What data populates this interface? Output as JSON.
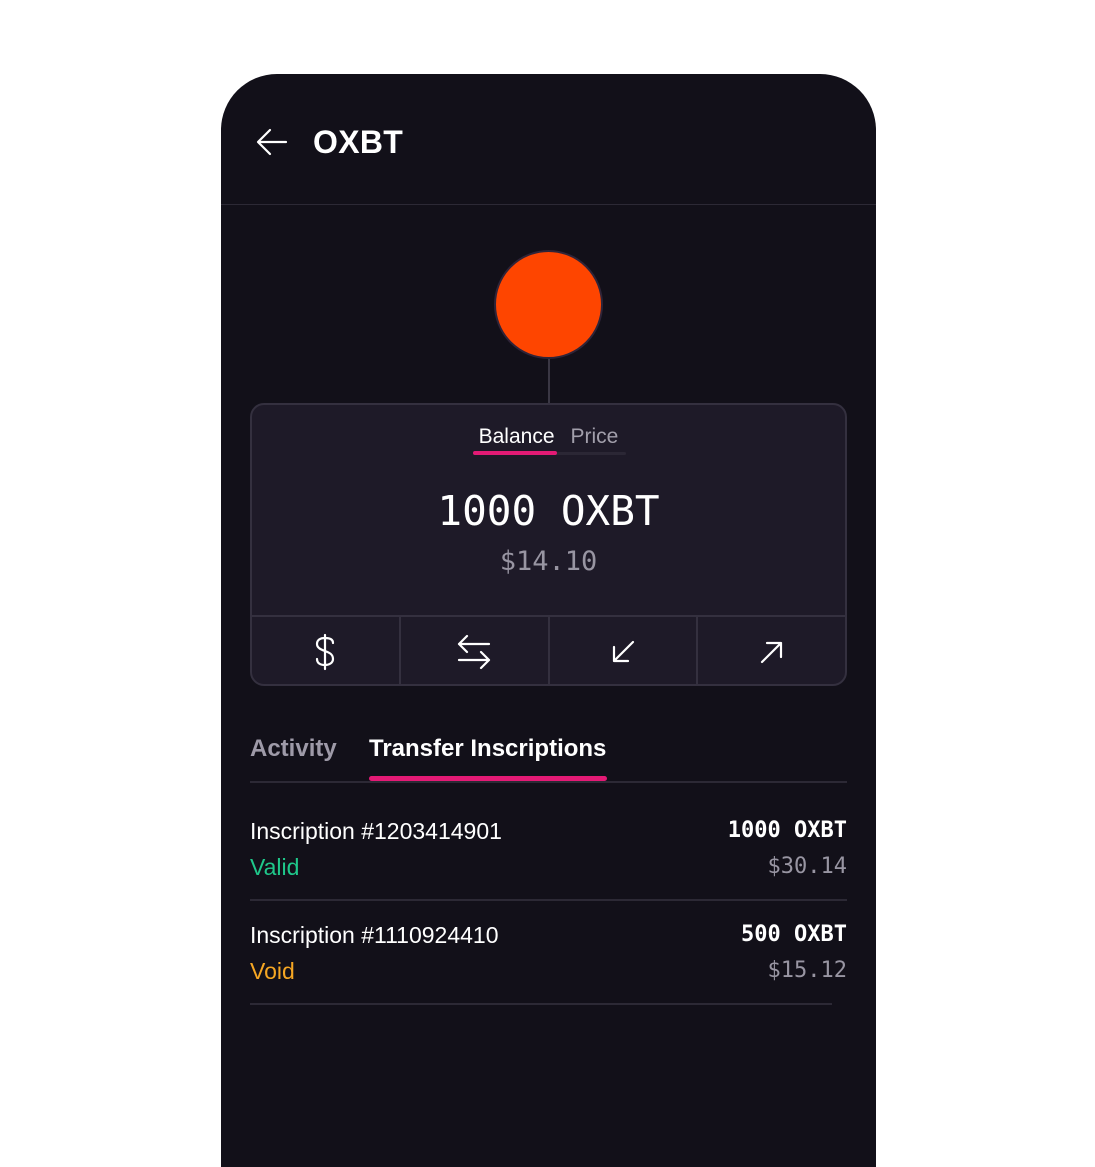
{
  "header": {
    "title": "OXBT",
    "back_icon": "arrow-left-icon"
  },
  "token": {
    "logo_color": "#fe4500"
  },
  "balance_card": {
    "segments": [
      {
        "label": "Balance",
        "active": true
      },
      {
        "label": "Price",
        "active": false
      }
    ],
    "amount": "1000 OXBT",
    "fiat": "$14.10",
    "actions": [
      {
        "name": "buy",
        "icon": "dollar-icon"
      },
      {
        "name": "swap",
        "icon": "swap-arrows-icon"
      },
      {
        "name": "receive",
        "icon": "arrow-down-left-icon"
      },
      {
        "name": "send",
        "icon": "arrow-up-right-icon"
      }
    ]
  },
  "tabs": [
    {
      "label": "Activity",
      "active": false
    },
    {
      "label": "Transfer Inscriptions",
      "active": true
    }
  ],
  "inscriptions": [
    {
      "name": "Inscription #1203414901",
      "status": "Valid",
      "status_color": "#1fc78a",
      "amount": "1000 OXBT",
      "fiat": "$30.14"
    },
    {
      "name": "Inscription #1110924410",
      "status": "Void",
      "status_color": "#f5a623",
      "amount": "500 OXBT",
      "fiat": "$15.12"
    }
  ],
  "colors": {
    "background": "#121019",
    "card": "#1e1a28",
    "accent": "#e31a75"
  }
}
